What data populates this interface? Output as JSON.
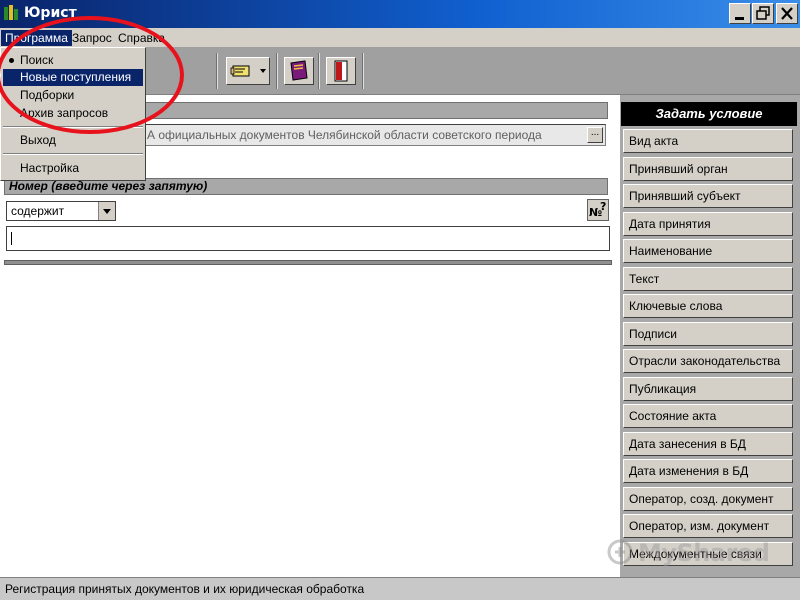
{
  "window": {
    "title": "Юрист",
    "icon": "app-logo-icon"
  },
  "menubar": {
    "items": [
      {
        "label": "Программа",
        "active": true
      },
      {
        "label": "Запрос",
        "active": false
      },
      {
        "label": "Справка",
        "active": false
      }
    ]
  },
  "program_menu": {
    "items": [
      {
        "label": "Поиск",
        "checked": true
      },
      {
        "label": "Новые поступления",
        "selected": true
      },
      {
        "label": "Подборки"
      },
      {
        "label": "Архив запросов"
      },
      {
        "label": "Выход"
      },
      {
        "label": "Настройка"
      }
    ]
  },
  "toolbar": {
    "buttons": [
      {
        "icon": "hand-pointer-icon",
        "has_dropdown": true
      },
      {
        "icon": "book-icon"
      },
      {
        "icon": "door-exit-icon"
      }
    ]
  },
  "search": {
    "database_value": "А официальных документов Челябинской области советского периода",
    "browse_label": "...",
    "number_section_label": "Номер (введите через запятую)",
    "condition_value": "содержит",
    "number_value": ""
  },
  "conditions_panel": {
    "header": "Задать условие",
    "buttons": [
      "Вид акта",
      "Принявший орган",
      "Принявший субъект",
      "Дата принятия",
      "Наименование",
      "Текст",
      "Ключевые слова",
      "Подписи",
      "Отрасли законодательства",
      "Публикация",
      "Состояние акта",
      "Дата занесения в БД",
      "Дата изменения в БД",
      "Оператор, созд. документ",
      "Оператор, изм. документ",
      "Междокументные связи"
    ]
  },
  "statusbar": {
    "text": "Регистрация принятых документов и их юридическая обработка"
  },
  "watermark": {
    "text": "MyShared"
  },
  "colors": {
    "titlebar": "#0a246a",
    "highlight": "#0a246a",
    "annotation_oval": "#e8121c"
  }
}
